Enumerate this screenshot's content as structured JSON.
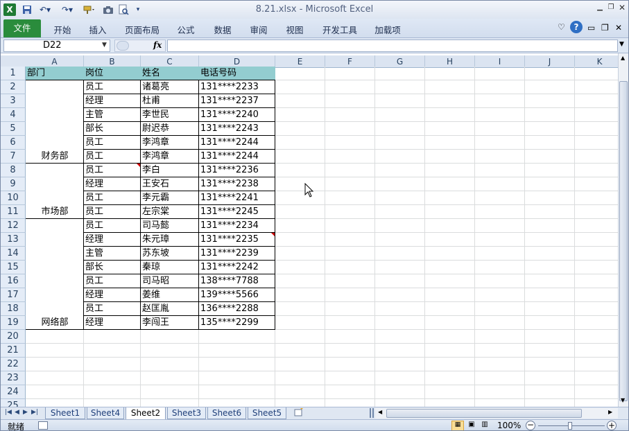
{
  "window": {
    "title": "8.21.xlsx  -  Microsoft Excel"
  },
  "ribbon": {
    "file_label": "文件",
    "tabs": [
      "开始",
      "插入",
      "页面布局",
      "公式",
      "数据",
      "审阅",
      "视图",
      "开发工具",
      "加载项"
    ]
  },
  "formula_bar": {
    "name_box": "D22",
    "fx_label": "fx",
    "content": ""
  },
  "columns": [
    "A",
    "B",
    "C",
    "D",
    "E",
    "F",
    "G",
    "H",
    "I",
    "J",
    "K"
  ],
  "rows": [
    "1",
    "2",
    "3",
    "4",
    "5",
    "6",
    "7",
    "8",
    "9",
    "10",
    "11",
    "12",
    "13",
    "14",
    "15",
    "16",
    "17",
    "18",
    "19",
    "20",
    "21",
    "22",
    "23",
    "24",
    "25"
  ],
  "table": {
    "headers": [
      "部门",
      "岗位",
      "姓名",
      "电话号码"
    ],
    "departments": [
      {
        "label": "财务部"
      },
      {
        "label": "市场部"
      },
      {
        "label": "网络部"
      }
    ],
    "rows": [
      [
        "员工",
        "诸葛亮",
        "131****2233"
      ],
      [
        "经理",
        "杜甫",
        "131****2237"
      ],
      [
        "主管",
        "李世民",
        "131****2240"
      ],
      [
        "部长",
        "尉迟恭",
        "131****2243"
      ],
      [
        "员工",
        "李鸿章",
        "131****2244"
      ],
      [
        "员工",
        "李鸿章",
        "131****2244"
      ],
      [
        "员工",
        "李白",
        "131****2236"
      ],
      [
        "经理",
        "王安石",
        "131****2238"
      ],
      [
        "员工",
        "李元霸",
        "131****2241"
      ],
      [
        "员工",
        "左宗棠",
        "131****2245"
      ],
      [
        "员工",
        "司马懿",
        "131****2234"
      ],
      [
        "经理",
        "朱元璋",
        "131****2235"
      ],
      [
        "主管",
        "苏东坡",
        "131****2239"
      ],
      [
        "部长",
        "秦琼",
        "131****2242"
      ],
      [
        "员工",
        "司马昭",
        "138****7788"
      ],
      [
        "经理",
        "姜维",
        "139****5566"
      ],
      [
        "员工",
        "赵匡胤",
        "136****2288"
      ],
      [
        "经理",
        "李闯王",
        "135****2299"
      ]
    ]
  },
  "sheets": [
    {
      "name": "Sheet1",
      "active": false
    },
    {
      "name": "Sheet4",
      "active": false
    },
    {
      "name": "Sheet2",
      "active": true
    },
    {
      "name": "Sheet3",
      "active": false
    },
    {
      "name": "Sheet6",
      "active": false
    },
    {
      "name": "Sheet5",
      "active": false
    }
  ],
  "status": {
    "ready": "就绪",
    "zoom": "100%"
  },
  "colors": {
    "header_fill": "#93cdd0",
    "comment_marker": "#d00000",
    "file_tab": "#2a8c3c"
  }
}
